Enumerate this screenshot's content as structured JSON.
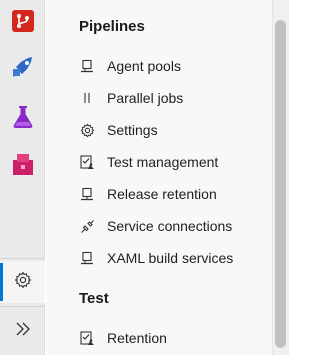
{
  "rail": {
    "items": [
      {
        "name": "repos",
        "icon": "repos-icon",
        "color": "#d4281f"
      },
      {
        "name": "pipelines",
        "icon": "pipelines-icon",
        "color": "#2f67c6"
      },
      {
        "name": "test-plans",
        "icon": "test-plans-icon",
        "color": "#8a2bc9"
      },
      {
        "name": "artifacts",
        "icon": "artifacts-icon",
        "color": "#cc1f6a"
      }
    ],
    "settings_icon": "gear-icon",
    "expand_icon": "chevrons-right-icon"
  },
  "sections": {
    "pipelines": {
      "title": "Pipelines",
      "items": [
        {
          "label": "Agent pools",
          "icon": "agent-icon"
        },
        {
          "label": "Parallel jobs",
          "icon": "parallel-icon"
        },
        {
          "label": "Settings",
          "icon": "gear-icon"
        },
        {
          "label": "Test management",
          "icon": "checklist-icon"
        },
        {
          "label": "Release retention",
          "icon": "retention-icon"
        },
        {
          "label": "Service connections",
          "icon": "plug-icon"
        },
        {
          "label": "XAML build services",
          "icon": "agent-icon"
        }
      ]
    },
    "test": {
      "title": "Test",
      "items": [
        {
          "label": "Retention",
          "icon": "checklist-icon"
        }
      ]
    }
  },
  "colors": {
    "accent": "#0078d4",
    "rail_bg": "#eaeaea",
    "panel_bg": "#f8f8f8"
  }
}
